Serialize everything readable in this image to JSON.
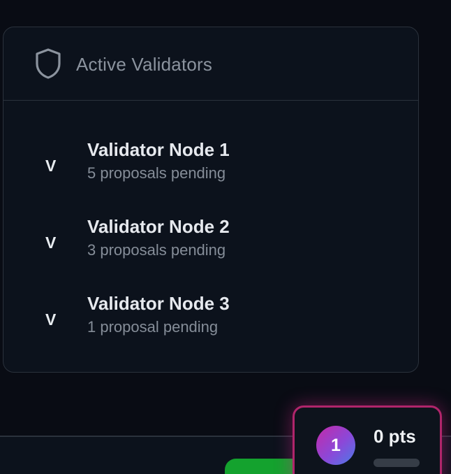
{
  "validators_card": {
    "title": "Active Validators",
    "icon": "shield-icon",
    "items": [
      {
        "initial": "V",
        "name": "Validator Node 1",
        "status": "5 proposals pending"
      },
      {
        "initial": "V",
        "name": "Validator Node 2",
        "status": "3 proposals pending"
      },
      {
        "initial": "V",
        "name": "Validator Node 3",
        "status": "1 proposal pending"
      }
    ]
  },
  "points_widget": {
    "level": "1",
    "points_label": "0 pts",
    "progress_fraction": 0,
    "accent_color": "#b0256b"
  },
  "colors": {
    "background": "#090c14",
    "card": "#0c121c",
    "action_green": "#14a22e"
  }
}
